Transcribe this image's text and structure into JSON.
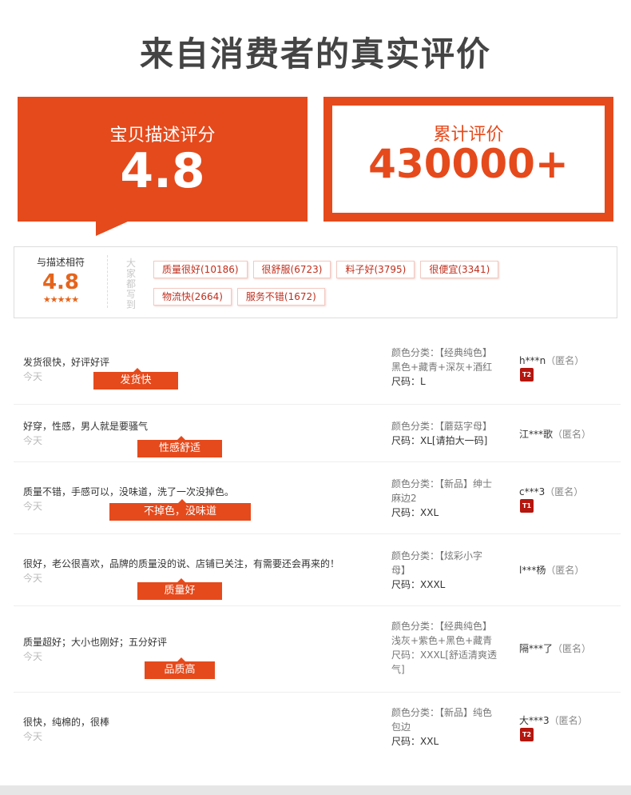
{
  "title": "来自消费者的真实评价",
  "score": {
    "label": "宝贝描述评分",
    "value": "4.8"
  },
  "total": {
    "label": "累计评价",
    "value": "430000+"
  },
  "match": {
    "label": "与描述相符",
    "value": "4.8",
    "stars": "★★★★★"
  },
  "panel_side_label": "大家都写到",
  "tags": [
    "质量很好(10186)",
    "很舒服(6723)",
    "料子好(3795)",
    "很便宜(3341)",
    "物流快(2664)",
    "服务不错(1672)"
  ],
  "reviews": [
    {
      "text": "发货很快，好评好评",
      "date": "今天",
      "highlight": "发货快",
      "spec": [
        "颜色分类：【经典纯色】",
        "黑色+藏青+深灰+酒红",
        "尺码：L"
      ],
      "user": "h***n",
      "anon": "（匿名）",
      "badge": "T2"
    },
    {
      "text": "好穿，性感，男人就是要骚气",
      "date": "今天",
      "highlight": "性感舒适",
      "spec": [
        "颜色分类：【蘑菇字母】",
        "尺码：XL[请拍大一码]"
      ],
      "user": "江***歌",
      "anon": "（匿名）",
      "badge": ""
    },
    {
      "text": "质量不错，手感可以，没味道，洗了一次没掉色。",
      "date": "今天",
      "highlight": "不掉色，没味道",
      "spec": [
        "颜色分类：【新品】绅士",
        "麻边2",
        "尺码：XXL"
      ],
      "user": "c***3",
      "anon": "（匿名）",
      "badge": "T1"
    },
    {
      "text": "很好，老公很喜欢，品牌的质量没的说、店铺已关注，有需要还会再来的！",
      "date": "今天",
      "highlight": "质量好",
      "spec": [
        "颜色分类：【炫彩小字",
        "母】",
        "尺码：XXXL"
      ],
      "user": "l***杨",
      "anon": "（匿名）",
      "badge": ""
    },
    {
      "text": "质量超好；大小也刚好；五分好评",
      "date": "今天",
      "highlight": "品质高",
      "spec": [
        "颜色分类：【经典纯色】",
        "浅灰+紫色+黑色+藏青",
        "尺码：XXXL[舒适清爽透",
        "气]"
      ],
      "user": "隔***了",
      "anon": "（匿名）",
      "badge": ""
    },
    {
      "text": "很快，纯棉的，很棒",
      "date": "今天",
      "highlight": "",
      "spec": [
        "颜色分类：【新品】纯色",
        "包边",
        "尺码：XXL"
      ],
      "user": "大***3",
      "anon": "（匿名）",
      "badge": "T2"
    }
  ]
}
